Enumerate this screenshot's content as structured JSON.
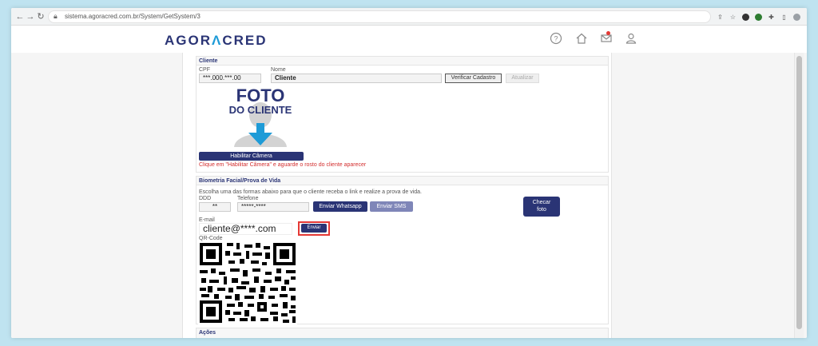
{
  "browser": {
    "url": "sistema.agoracred.com.br/System/GetSystem/3"
  },
  "header": {
    "logo_left": "AGOR",
    "logo_accent": "Λ",
    "logo_right": "CRED"
  },
  "cliente": {
    "section_title": "Cliente",
    "cpf_label": "CPF",
    "cpf_value": "***.000.***.00",
    "nome_label": "Nome",
    "nome_value": "Cliente",
    "verificar_button": "Verificar Cadastro",
    "atualizar_button": "Atualizar",
    "photo_line1": "FOTO",
    "photo_line2": "DO CLIENTE",
    "camera_button": "Habilitar Câmera",
    "camera_hint": "Clique em \"Habilitar Câmera\" e aguarde o rosto do cliente aparecer"
  },
  "biometria": {
    "section_title": "Biometria Facial/Prova de Vida",
    "instructions": "Escolha uma das formas abaixo para que o cliente receba o link e realize a prova de vida.",
    "ddd_label": "DDD",
    "ddd_value": "**",
    "telefone_label": "Telefone",
    "telefone_value": "*****-****",
    "whatsapp_button": "Enviar Whatsapp",
    "sms_button": "Enviar SMS",
    "checar_line1": "Checar",
    "checar_line2": "foto",
    "email_label": "E-mail",
    "email_value": "cliente@****.com",
    "enviar_button": "Enviar",
    "qr_label": "QR-Code"
  },
  "acoes": {
    "section_title": "Ações"
  },
  "colors": {
    "brand": "#2a3475",
    "accent": "#1e9bd7",
    "sms": "#7f86b8",
    "highlight": "#e53935"
  }
}
